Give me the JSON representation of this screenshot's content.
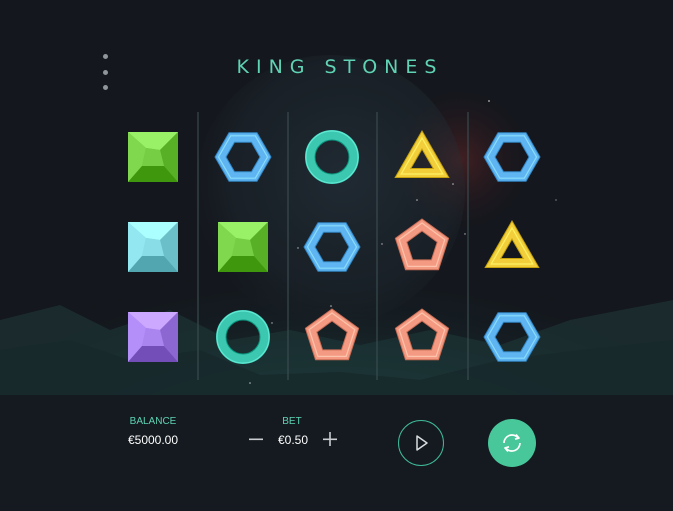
{
  "game": {
    "title": "KING STONES"
  },
  "colors": {
    "accent": "#5fd3b4",
    "spin_button": "#48c79a",
    "gem_green": "#6cc43a",
    "gem_blue_hexagon": "#5fb4f2",
    "gem_teal_ring": "#3cc7b0",
    "gem_yellow_triangle": "#f2cf3a",
    "gem_teal_square": "#7fd3dc",
    "gem_coral_pentagon": "#f59a82",
    "gem_purple": "#a07be6"
  },
  "reels": [
    [
      "green-gem",
      "teal-square-gem",
      "purple-gem"
    ],
    [
      "blue-hexagon",
      "green-gem",
      "teal-ring"
    ],
    [
      "teal-ring",
      "blue-hexagon",
      "coral-pentagon"
    ],
    [
      "yellow-triangle",
      "coral-pentagon",
      "coral-pentagon"
    ],
    [
      "blue-hexagon",
      "yellow-triangle",
      "blue-hexagon"
    ]
  ],
  "footer": {
    "balance_label": "BALANCE",
    "balance_value": "€5000.00",
    "bet_label": "BET",
    "bet_value": "€0.50",
    "decrease_symbol": "—",
    "increase_symbol": "+"
  },
  "icons": {
    "menu": "menu-dots-icon",
    "play": "play-icon",
    "spin": "spin-arrows-icon"
  }
}
